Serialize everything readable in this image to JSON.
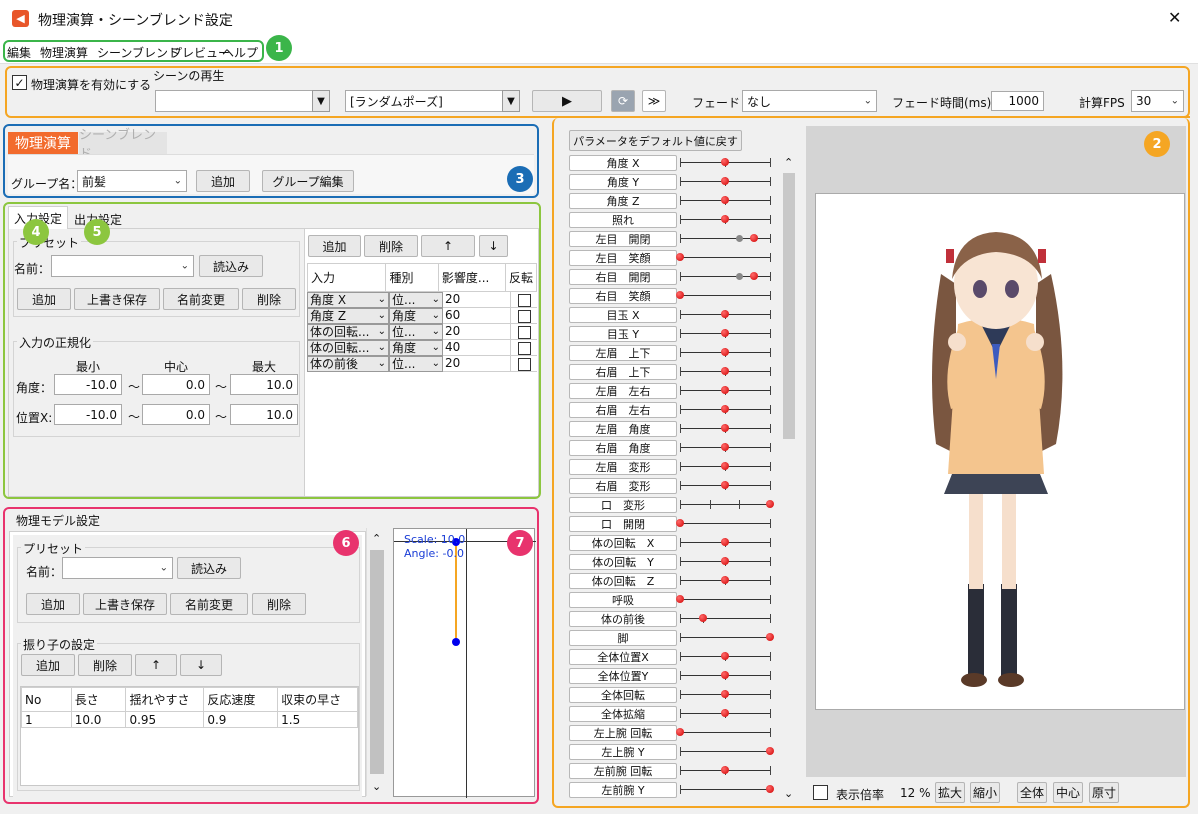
{
  "window": {
    "title": "物理演算・シーンブレンド設定",
    "close": "✕"
  },
  "menu": [
    "編集",
    "物理演算",
    "シーンブレンド",
    "プレビュー",
    "ヘルプ"
  ],
  "badges": [
    "1",
    "2",
    "3",
    "4",
    "5",
    "6",
    "7"
  ],
  "colors": {
    "green": "#3bb54a",
    "orange": "#f5a623",
    "blue": "#1b6db5",
    "lime": "#8cc63f",
    "pink": "#e8336d",
    "tab_active": "#f26b2d"
  },
  "toolbar": {
    "physics_enabled_label": "物理演算を有効にする",
    "physics_enabled": true,
    "scene_play_label": "シーンの再生",
    "scene_select_value": "",
    "pose_select_value": "[ランダムポーズ]",
    "fade_label": "フェード：",
    "fade_value": "なし",
    "fade_time_label": "フェード時間(ms)：",
    "fade_time_value": "1000",
    "fps_label": "計算FPS",
    "fps_value": "30"
  },
  "mode_tabs": {
    "physics": "物理演算",
    "scene": "シーンブレンド"
  },
  "group": {
    "label": "グループ名：",
    "value": "前髪",
    "add": "追加",
    "edit": "グループ編集"
  },
  "io_tabs": {
    "input": "入力設定",
    "output": "出力設定"
  },
  "preset": {
    "title": "プリセット",
    "name_label": "名前：",
    "load": "読込み",
    "add": "追加",
    "overwrite": "上書き保存",
    "rename": "名前変更",
    "delete": "削除"
  },
  "normalize": {
    "title": "入力の正規化",
    "min": "最小",
    "center": "中心",
    "max": "最大",
    "angle_label": "角度：",
    "pos_label": "位置X:",
    "tilde": "〜",
    "angle_min": "-10.0",
    "angle_center": "0.0",
    "angle_max": "10.0",
    "pos_min": "-10.0",
    "pos_center": "0.0",
    "pos_max": "10.0"
  },
  "input_table": {
    "add": "追加",
    "delete": "削除",
    "up": "↑",
    "down": "↓",
    "headers": [
      "入力",
      "種別",
      "影響度...",
      "反転"
    ],
    "rows": [
      {
        "input": "角度 X",
        "type": "位...",
        "weight": "20"
      },
      {
        "input": "角度 Z",
        "type": "角度",
        "weight": "60"
      },
      {
        "input": "体の回転...",
        "type": "位...",
        "weight": "20"
      },
      {
        "input": "体の回転...",
        "type": "角度",
        "weight": "40"
      },
      {
        "input": "体の前後",
        "type": "位...",
        "weight": "20"
      }
    ]
  },
  "physics_model": {
    "title": "物理モデル設定",
    "pendulum_title": "振り子の設定",
    "headers": [
      "No",
      "長さ",
      "揺れやすさ",
      "反応速度",
      "収束の早さ"
    ],
    "rows": [
      {
        "no": "1",
        "length": "10.0",
        "ease": "0.95",
        "speed": "0.9",
        "conv": "1.5"
      }
    ]
  },
  "graph": {
    "scale": "Scale: 10.0",
    "angle": "Angle: -0.0"
  },
  "params": {
    "reset": "パラメータをデフォルト値に戻す",
    "items": [
      {
        "label": "角度 X",
        "ticks": [
          0,
          0.5,
          1
        ],
        "dots": [
          0.5
        ]
      },
      {
        "label": "角度 Y",
        "ticks": [
          0,
          0.5,
          1
        ],
        "dots": [
          0.5
        ]
      },
      {
        "label": "角度 Z",
        "ticks": [
          0,
          0.5,
          1
        ],
        "dots": [
          0.5
        ]
      },
      {
        "label": "照れ",
        "ticks": [
          0,
          0.5,
          1
        ],
        "dots": [
          0.5
        ]
      },
      {
        "label": "左目　開閉",
        "ticks": [
          0,
          1
        ],
        "gray": [
          0.66
        ],
        "dots": [
          0.82
        ]
      },
      {
        "label": "左目　笑顔",
        "ticks": [
          1
        ],
        "dots": [
          0
        ]
      },
      {
        "label": "右目　開閉",
        "ticks": [
          0,
          1
        ],
        "gray": [
          0.66
        ],
        "dots": [
          0.82
        ]
      },
      {
        "label": "右目　笑顔",
        "ticks": [
          1
        ],
        "dots": [
          0
        ]
      },
      {
        "label": "目玉 X",
        "ticks": [
          0,
          0.5,
          1
        ],
        "dots": [
          0.5
        ]
      },
      {
        "label": "目玉 Y",
        "ticks": [
          0,
          0.5,
          1
        ],
        "dots": [
          0.5
        ]
      },
      {
        "label": "左眉　上下",
        "ticks": [
          0,
          0.5,
          1
        ],
        "dots": [
          0.5
        ]
      },
      {
        "label": "右眉　上下",
        "ticks": [
          0,
          0.5,
          1
        ],
        "dots": [
          0.5
        ]
      },
      {
        "label": "左眉　左右",
        "ticks": [
          0,
          0.5,
          1
        ],
        "dots": [
          0.5
        ]
      },
      {
        "label": "右眉　左右",
        "ticks": [
          0,
          0.5,
          1
        ],
        "dots": [
          0.5
        ]
      },
      {
        "label": "左眉　角度",
        "ticks": [
          0,
          0.5,
          1
        ],
        "dots": [
          0.5
        ]
      },
      {
        "label": "右眉　角度",
        "ticks": [
          0,
          0.5,
          1
        ],
        "dots": [
          0.5
        ]
      },
      {
        "label": "左眉　変形",
        "ticks": [
          0,
          0.5,
          1
        ],
        "dots": [
          0.5
        ]
      },
      {
        "label": "右眉　変形",
        "ticks": [
          0,
          0.5,
          1
        ],
        "dots": [
          0.5
        ]
      },
      {
        "label": "口　変形",
        "ticks": [
          0,
          0.33,
          0.66
        ],
        "dots": [
          1
        ]
      },
      {
        "label": "口　開閉",
        "ticks": [
          1
        ],
        "dots": [
          0
        ]
      },
      {
        "label": "体の回転　X",
        "ticks": [
          0,
          0.5,
          1
        ],
        "dots": [
          0.5
        ]
      },
      {
        "label": "体の回転　Y",
        "ticks": [
          0,
          0.5,
          1
        ],
        "dots": [
          0.5
        ]
      },
      {
        "label": "体の回転　Z",
        "ticks": [
          0,
          0.5,
          1
        ],
        "dots": [
          0.5
        ]
      },
      {
        "label": "呼吸",
        "ticks": [
          1
        ],
        "dots": [
          0
        ]
      },
      {
        "label": "体の前後",
        "ticks": [
          0,
          0.25,
          1
        ],
        "dots": [
          0.25
        ]
      },
      {
        "label": "脚",
        "ticks": [
          0
        ],
        "dots": [
          1
        ]
      },
      {
        "label": "全体位置X",
        "ticks": [
          0,
          0.5,
          1
        ],
        "dots": [
          0.5
        ]
      },
      {
        "label": "全体位置Y",
        "ticks": [
          0,
          0.5,
          1
        ],
        "dots": [
          0.5
        ]
      },
      {
        "label": "全体回転",
        "ticks": [
          0,
          0.5,
          1
        ],
        "dots": [
          0.5
        ]
      },
      {
        "label": "全体拡縮",
        "ticks": [
          0,
          0.5,
          1
        ],
        "dots": [
          0.5
        ]
      },
      {
        "label": "左上腕 回転",
        "ticks": [
          1
        ],
        "dots": [
          0
        ]
      },
      {
        "label": "左上腕 Y",
        "ticks": [
          0
        ],
        "dots": [
          1
        ]
      },
      {
        "label": "左前腕 回転",
        "ticks": [
          0,
          0.5,
          1
        ],
        "dots": [
          0.5
        ]
      },
      {
        "label": "左前腕 Y",
        "ticks": [
          0
        ],
        "dots": [
          1
        ]
      }
    ]
  },
  "preview": {
    "zoom_label": "表示倍率",
    "zoom_value": "12 %",
    "zoom_in": "拡大",
    "zoom_out": "縮小",
    "fit": "全体",
    "center": "中心",
    "actual": "原寸"
  }
}
